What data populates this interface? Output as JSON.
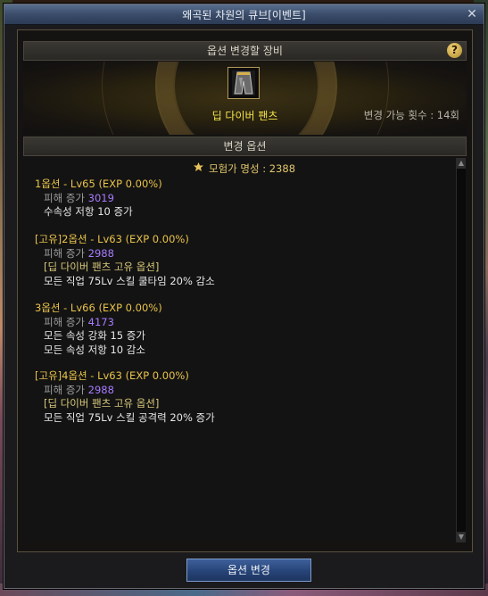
{
  "window": {
    "title": "왜곡된 차원의 큐브[이벤트]",
    "close_icon": "✕"
  },
  "equip_section": {
    "header": "옵션 변경할 장비",
    "help_label": "?",
    "item_name": "딥 다이버 팬츠",
    "change_count": "변경 가능 횟수 : 14회"
  },
  "options_section": {
    "header": "변경 옵션",
    "renown_icon": "emblem-icon",
    "renown_text": "모험가 명성 : 2388",
    "options": [
      {
        "title": "1옵션 - Lv65 (EXP 0.00%)",
        "dmg_label": "피해 증가 ",
        "dmg_value": "3019",
        "lines": [
          "수속성 저항 10 증가"
        ]
      },
      {
        "title": "[고유]2옵션 - Lv63 (EXP 0.00%)",
        "dmg_label": "피해 증가 ",
        "dmg_value": "2988",
        "unique": "[딥 다이버 팬츠 고유 옵션]",
        "lines": [
          "모든 직업 75Lv 스킬 쿨타임 20% 감소"
        ]
      },
      {
        "title": "3옵션 - Lv66 (EXP 0.00%)",
        "dmg_label": "피해 증가 ",
        "dmg_value": "4173",
        "lines": [
          "모든 속성 강화 15 증가",
          "모든 속성 저항 10 감소"
        ]
      },
      {
        "title": "[고유]4옵션 - Lv63 (EXP 0.00%)",
        "dmg_label": "피해 증가 ",
        "dmg_value": "2988",
        "unique": "[딥 다이버 팬츠 고유 옵션]",
        "lines": [
          "모든 직업 75Lv 스킬 공격력 20% 증가"
        ]
      }
    ]
  },
  "scroll": {
    "up_icon": "▲",
    "down_icon": "▼"
  },
  "action": {
    "change_button": "옵션 변경"
  },
  "colors": {
    "title_gold": "#e9c34a",
    "item_yellow": "#f2e24a",
    "damage_purple": "#a87bff",
    "button_blue": "#274478"
  }
}
